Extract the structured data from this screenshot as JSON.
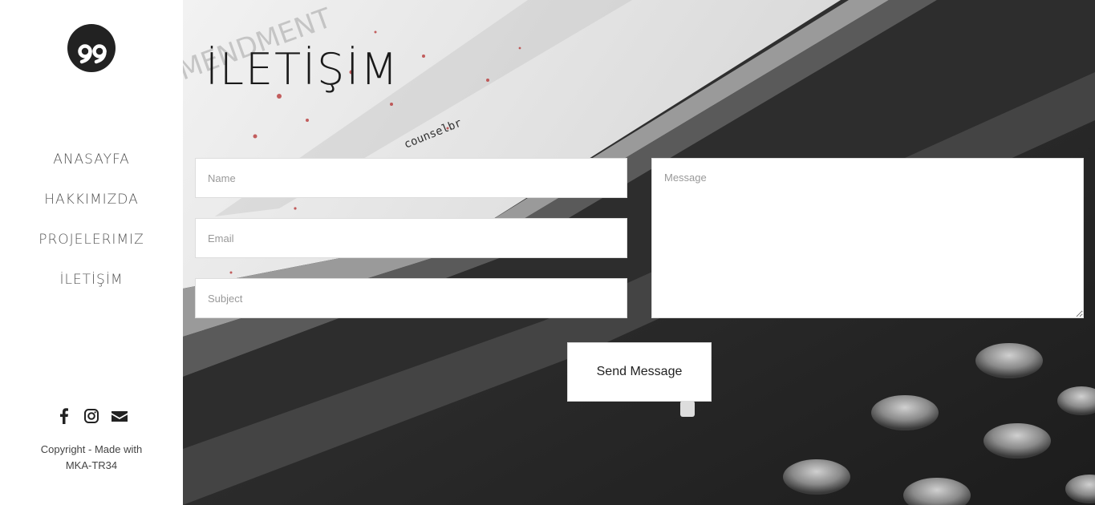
{
  "sidebar": {
    "nav": [
      {
        "label": "ANASAYFA"
      },
      {
        "label": "HAKKIMIZDA"
      },
      {
        "label": "PROJELERIMIZ"
      },
      {
        "label": "İLETİŞİM"
      }
    ],
    "social_icons": [
      "facebook-icon",
      "instagram-icon",
      "envelope-icon"
    ],
    "copyright_line1": "Copyright - Made with",
    "copyright_line2": "MKA-TR34"
  },
  "main": {
    "title": "İLETİŞİM",
    "form": {
      "name_placeholder": "Name",
      "email_placeholder": "Email",
      "subject_placeholder": "Subject",
      "message_placeholder": "Message",
      "send_label": "Send Message"
    }
  },
  "colors": {
    "sidebar_bg": "#ffffff",
    "nav_text": "#555555",
    "dark_bg": "#2a2a2a"
  }
}
